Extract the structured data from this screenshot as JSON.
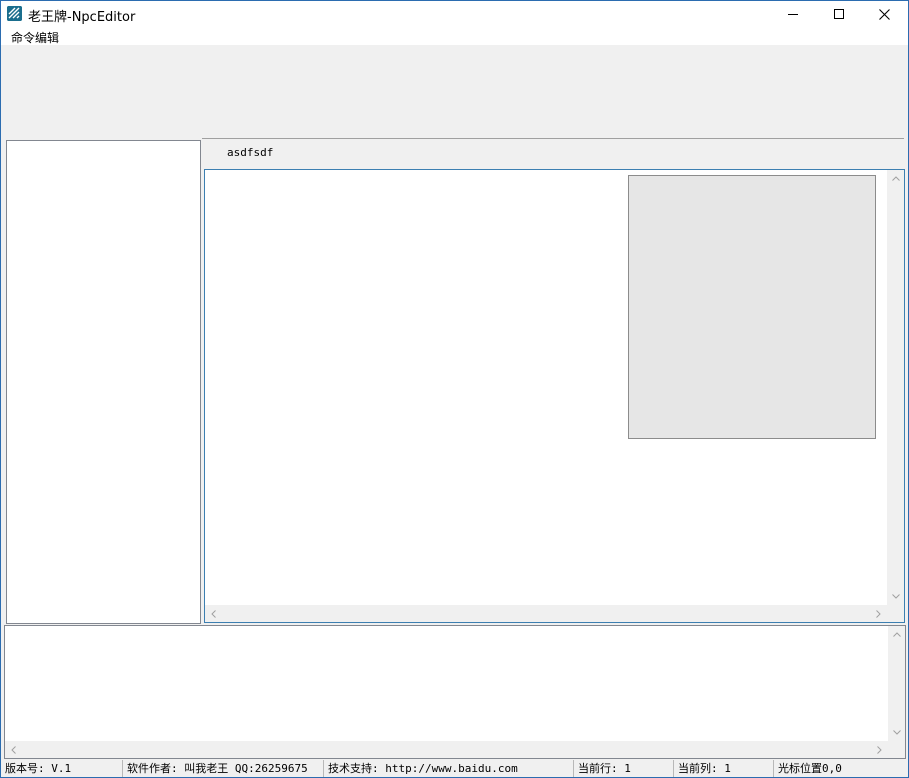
{
  "window": {
    "title": "老王牌-NpcEditor",
    "icon": "app-logo-icon"
  },
  "menu": {
    "items": [
      {
        "label": "命令编辑"
      }
    ]
  },
  "editor": {
    "tab_label": "asdfsdf"
  },
  "status": {
    "version": "版本号: V.1",
    "author": "软件作者: 叫我老王 QQ:26259675",
    "support": "技术支持: http://www.baidu.com",
    "current_row": "当前行: 1",
    "current_col": "当前列: 1",
    "cursor_pos": "光标位置0,0"
  },
  "colors": {
    "accent": "#3c7fb1",
    "chrome": "#f0f0f0",
    "preview": "#e6e6e6"
  }
}
